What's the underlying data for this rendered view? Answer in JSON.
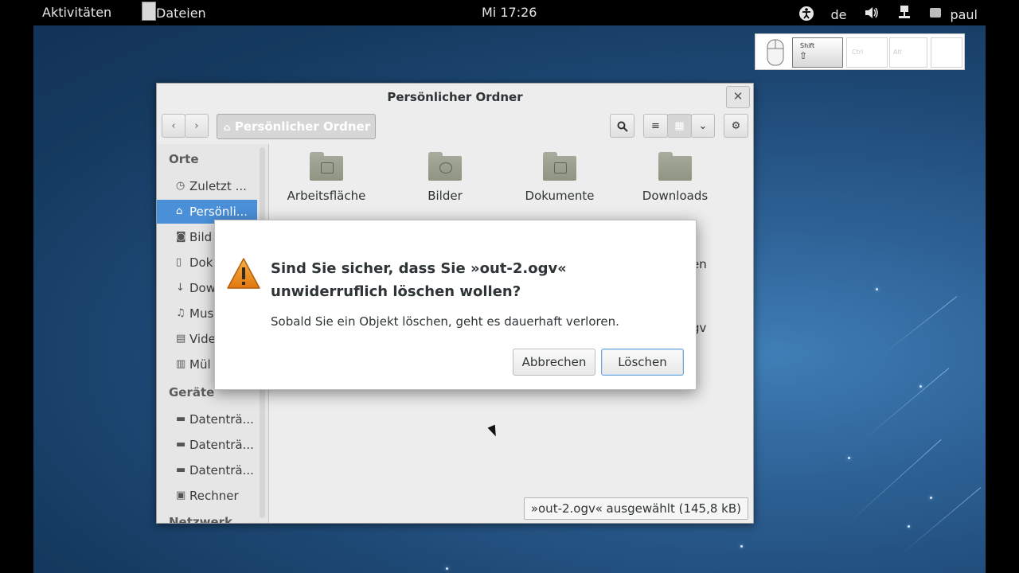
{
  "topbar": {
    "activities": "Aktivitäten",
    "app_name": "Dateien",
    "clock": "Mi 17:26",
    "keyboard_layout": "de",
    "user": "paul"
  },
  "keyboard_overlay": {
    "keys": [
      "Shift",
      "Ctrl",
      "Alt"
    ]
  },
  "window": {
    "title": "Persönlicher Ordner",
    "close_glyph": "✕",
    "breadcrumb": "Persönlicher Ordner"
  },
  "sidebar": {
    "places_header": "Orte",
    "devices_header": "Geräte",
    "network_header_partial": "Netzwerk",
    "places": [
      {
        "label": "Zuletzt ...",
        "icon": "clock-icon"
      },
      {
        "label": "Persönli...",
        "icon": "home-icon",
        "selected": true
      },
      {
        "label": "Bild",
        "icon": "camera-icon"
      },
      {
        "label": "Dok",
        "icon": "document-icon"
      },
      {
        "label": "Dow",
        "icon": "download-icon"
      },
      {
        "label": "Mus",
        "icon": "music-icon"
      },
      {
        "label": "Vide",
        "icon": "video-icon"
      },
      {
        "label": "Mül",
        "icon": "trash-icon"
      }
    ],
    "devices": [
      {
        "label": "Datenträ...",
        "icon": "drive-icon"
      },
      {
        "label": "Datenträ...",
        "icon": "drive-icon"
      },
      {
        "label": "Datenträ...",
        "icon": "drive-icon"
      },
      {
        "label": "Rechner",
        "icon": "computer-icon"
      }
    ]
  },
  "files": [
    {
      "name": "Arbeitsfläche",
      "icon": "desktop-folder-icon"
    },
    {
      "name": "Bilder",
      "icon": "pictures-folder-icon"
    },
    {
      "name": "Dokumente",
      "icon": "documents-folder-icon"
    },
    {
      "name": "Downloads",
      "icon": "downloads-folder-icon"
    }
  ],
  "partial_labels": {
    "right_row2": "en",
    "right_row3": "gv"
  },
  "status": "»out-2.ogv« ausgewählt (145,8 kB)",
  "dialog": {
    "title": "Sind Sie sicher, dass Sie »out-2.ogv« unwiderruflich löschen wollen?",
    "message": "Sobald Sie ein Objekt löschen, geht es dauerhaft verloren.",
    "cancel": "Abbrechen",
    "delete": "Löschen"
  },
  "colors": {
    "selection": "#4a90d9",
    "topbar": "#000000",
    "warning": "#e8891c"
  }
}
